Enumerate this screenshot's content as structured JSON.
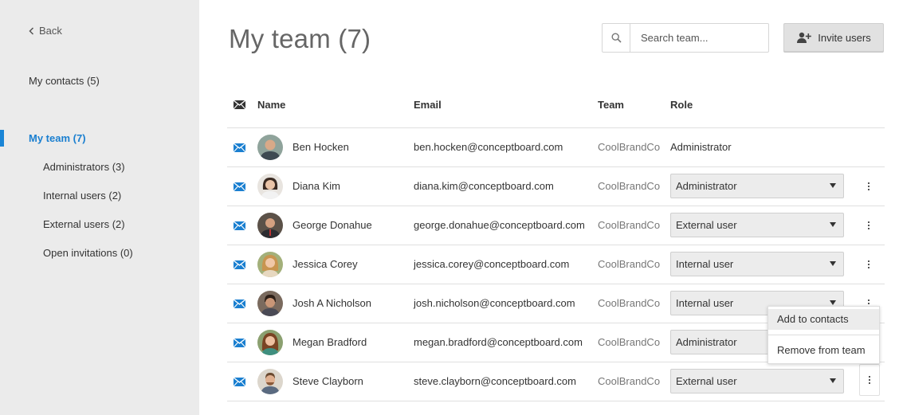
{
  "sidebar": {
    "back_label": "Back",
    "items": [
      {
        "label": "My contacts (5)"
      },
      {
        "label": "My team (7)"
      },
      {
        "label": "Administrators (3)"
      },
      {
        "label": "Internal users (2)"
      },
      {
        "label": "External users (2)"
      },
      {
        "label": "Open invitations (0)"
      }
    ]
  },
  "header": {
    "title": "My team (7)",
    "search_placeholder": "Search team...",
    "invite_label": "Invite users"
  },
  "table": {
    "columns": {
      "name": "Name",
      "email": "Email",
      "team": "Team",
      "role": "Role"
    },
    "rows": [
      {
        "name": "Ben Hocken",
        "email": "ben.hocken@conceptboard.com",
        "team": "CoolBrandCo",
        "role": "Administrator"
      },
      {
        "name": "Diana Kim",
        "email": "diana.kim@conceptboard.com",
        "team": "CoolBrandCo",
        "role": "Administrator"
      },
      {
        "name": "George Donahue",
        "email": "george.donahue@conceptboard.com",
        "team": "CoolBrandCo",
        "role": "External user"
      },
      {
        "name": "Jessica Corey",
        "email": "jessica.corey@conceptboard.com",
        "team": "CoolBrandCo",
        "role": "Internal user"
      },
      {
        "name": "Josh A Nicholson",
        "email": "josh.nicholson@conceptboard.com",
        "team": "CoolBrandCo",
        "role": "Internal user"
      },
      {
        "name": "Megan Bradford",
        "email": "megan.bradford@conceptboard.com",
        "team": "CoolBrandCo",
        "role": "Administrator"
      },
      {
        "name": "Steve Clayborn",
        "email": "steve.clayborn@conceptboard.com",
        "team": "CoolBrandCo",
        "role": "External user"
      }
    ]
  },
  "context_menu": {
    "items": [
      {
        "label": "Add to contacts"
      },
      {
        "label": "Remove from team"
      }
    ]
  },
  "colors": {
    "accent": "#1a7fd0",
    "mail_icon": "#1a7fd0",
    "sidebar_bg": "#ebebeb"
  },
  "icons": {
    "back": "chevron-left-icon",
    "search": "search-icon",
    "invite": "add-user-icon",
    "mail": "mail-icon",
    "more": "more-vertical-icon"
  }
}
